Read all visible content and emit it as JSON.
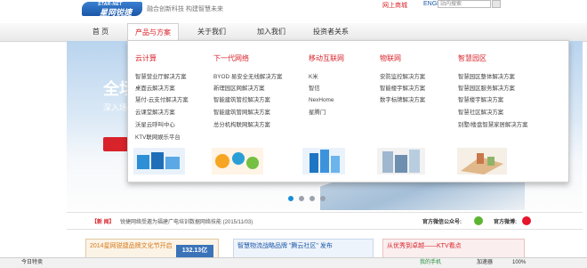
{
  "header": {
    "logo_en": "STAR-NET",
    "logo_cn": "星网锐捷",
    "slogan": "融合创新科技 构建智慧未来",
    "mall_link": "网上商城",
    "english_link": "ENGLISH",
    "search_placeholder": "站内搜索"
  },
  "nav": {
    "items": [
      "首 页",
      "产品与方案",
      "关于我们",
      "加入我们",
      "投资者关系"
    ]
  },
  "dropdown": {
    "columns": [
      {
        "title": "云计算",
        "items": [
          "智慧营业厅解决方案",
          "桌面云解决方案",
          "慧付-云支付解决方案",
          "云课堂解决方案",
          "沃星云呼叫中心",
          "KTV联网娱乐平台"
        ]
      },
      {
        "title": "下一代网络",
        "items": [
          "BYOD 易安全无线解决方案",
          "新理园区网解决方案",
          "智能建筑管控解决方案",
          "智能建筑管网解决方案",
          "总分机构联网解决方案"
        ]
      },
      {
        "title": "移动互联网",
        "items": [
          "K米",
          "智信",
          "NexHome",
          "星腾门"
        ]
      },
      {
        "title": "物联网",
        "items": [
          "安防监控解决方案",
          "智能楼宇解决方案",
          "数字标牌解决方案"
        ]
      },
      {
        "title": "智慧园区",
        "items": [
          "智慧园区整体解决方案",
          "智慧园区服务解决方案",
          "智慧楼宇解决方案",
          "智慧社区解决方案",
          "别墅/楼盘智慧家居解决方案"
        ]
      }
    ]
  },
  "banner": {
    "title": "全场",
    "subtitle": "深入场"
  },
  "news": {
    "label": "【新 闻】",
    "text": "锐捷网络受邀为福建广电培训数据网络技能   (2015/11/03)",
    "wechat_label": "官方微信公众号:",
    "weibo_label": "官方微博:"
  },
  "promos": [
    {
      "text": "2014星网锐捷品牌文化节开启"
    },
    {
      "badge": "132.13亿"
    },
    {
      "text": "智慧物流战略品牌 \"腾云社区\" 发布"
    },
    {
      "text": "从优秀到卓越——KTV看点"
    }
  ],
  "statusbar": {
    "left": "今日特卖",
    "phone": "我的手机",
    "accelerator": "加速器",
    "zoom": "100%"
  },
  "colors": {
    "accent": "#d8232a",
    "brand": "#1a56a8"
  }
}
